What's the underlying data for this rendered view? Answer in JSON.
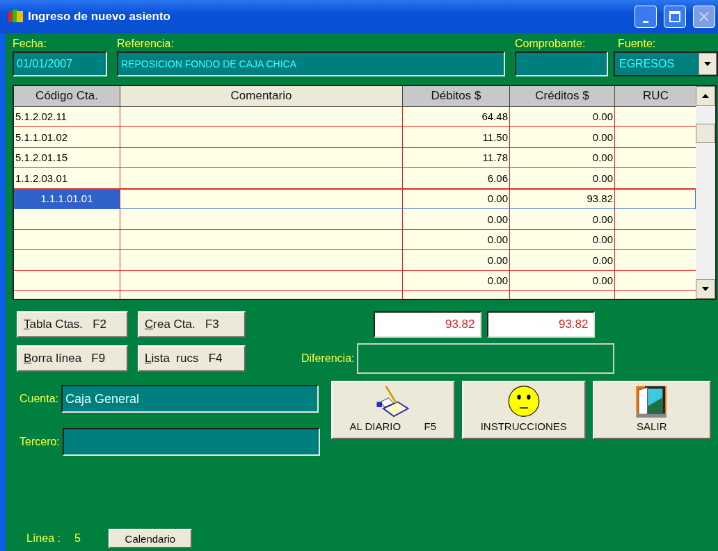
{
  "window": {
    "title": "Ingreso de nuevo asiento"
  },
  "header": {
    "fecha": {
      "label": "Fecha:",
      "value": "01/01/2007"
    },
    "referencia": {
      "label": "Referencia:",
      "value": "REPOSICION FONDO DE CAJA CHICA"
    },
    "comprobante": {
      "label": "Comprobante:"
    },
    "fuente": {
      "label": "Fuente:",
      "value": "EGRESOS"
    }
  },
  "table": {
    "columns": [
      "Código Cta.",
      "Comentario",
      "Débitos $",
      "Créditos $",
      "RUC"
    ],
    "rows": [
      {
        "codigo": "5.1.2.02.11",
        "debitos": "64.48",
        "creditos": "0.00",
        "selected": false
      },
      {
        "codigo": "5.1.1.01.02",
        "debitos": "11.50",
        "creditos": "0.00",
        "selected": false
      },
      {
        "codigo": "5.1.2.01.15",
        "debitos": "11.78",
        "creditos": "0.00",
        "selected": false
      },
      {
        "codigo": "1.1.2.03.01",
        "debitos": "6.06",
        "creditos": "0.00",
        "selected": false
      },
      {
        "codigo": "1.1.1.01.01",
        "debitos": "0.00",
        "creditos": "93.82",
        "selected": true
      },
      {
        "codigo": "",
        "debitos": "0.00",
        "creditos": "0.00",
        "selected": false
      },
      {
        "codigo": "",
        "debitos": "0.00",
        "creditos": "0.00",
        "selected": false
      },
      {
        "codigo": "",
        "debitos": "0.00",
        "creditos": "0.00",
        "selected": false
      },
      {
        "codigo": "",
        "debitos": "0.00",
        "creditos": "0.00",
        "selected": false
      }
    ]
  },
  "buttons": [
    {
      "label": "Tabla Ctas.",
      "key": "F2"
    },
    {
      "label": "Crea Cta.",
      "key": "F3"
    },
    {
      "label": "Borra línea",
      "key": "F9"
    },
    {
      "label": "Lista  rucs",
      "key": "F4"
    }
  ],
  "totals": {
    "debitos": "93.82",
    "creditos": "93.82"
  },
  "diferencia": {
    "label": "Diferencia:"
  },
  "cuenta": {
    "label": "Cuenta:",
    "value": "Caja General"
  },
  "tercero": {
    "label": "Tercero:"
  },
  "actions": [
    {
      "kind": "diary",
      "label": "AL DIARIO",
      "key": "F5"
    },
    {
      "kind": "smiley",
      "label": "INSTRUCCIONES"
    },
    {
      "kind": "door",
      "label": "SALIR"
    }
  ],
  "status": {
    "label": "Línea :",
    "value": "5",
    "calendar": "Calendario"
  }
}
